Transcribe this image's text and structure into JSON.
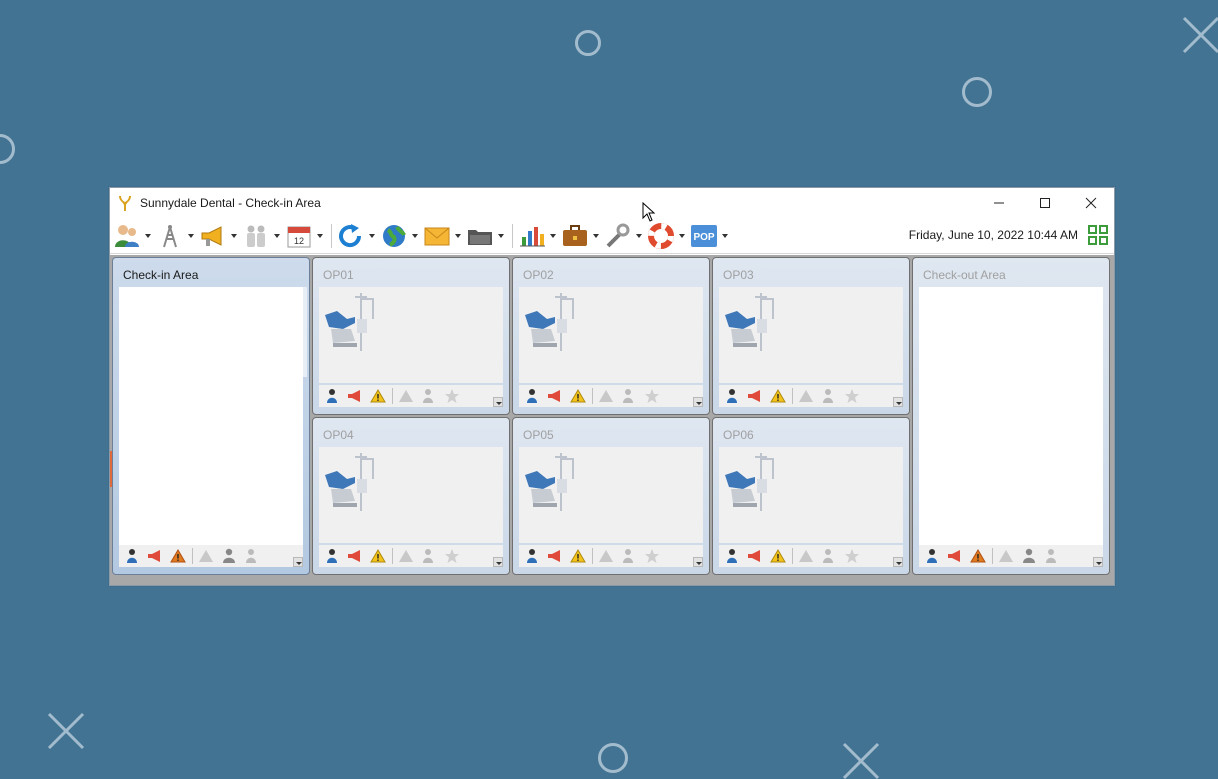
{
  "window": {
    "title": "Sunnydale Dental - Check-in Area",
    "controls": {
      "minimize": "—",
      "maximize": "☐",
      "close": "✕"
    }
  },
  "toolbar": {
    "items": [
      {
        "icon": "patients-icon"
      },
      {
        "icon": "antenna-icon"
      },
      {
        "icon": "megaphone-icon"
      },
      {
        "icon": "staff-icon"
      },
      {
        "icon": "calendar-icon",
        "text": "12"
      },
      {
        "icon": "refresh-icon"
      },
      {
        "icon": "globe-icon"
      },
      {
        "icon": "mail-icon"
      },
      {
        "icon": "folder-icon"
      },
      {
        "icon": "chart-icon"
      },
      {
        "icon": "briefcase-icon"
      },
      {
        "icon": "wrench-icon"
      },
      {
        "icon": "lifebuoy-icon"
      },
      {
        "icon": "pop-icon",
        "text": "POP"
      }
    ],
    "datetime": "Friday, June 10, 2022 10:44 AM"
  },
  "areas": {
    "checkin": {
      "title": "Check-in Area"
    },
    "checkout": {
      "title": "Check-out Area"
    },
    "operatories": [
      {
        "title": "OP01"
      },
      {
        "title": "OP02"
      },
      {
        "title": "OP03"
      },
      {
        "title": "OP04"
      },
      {
        "title": "OP05"
      },
      {
        "title": "OP06"
      }
    ]
  },
  "colors": {
    "desktop": "#437393",
    "panel_header": "#c9d7e8",
    "accent_tab": "#e06a3c"
  }
}
